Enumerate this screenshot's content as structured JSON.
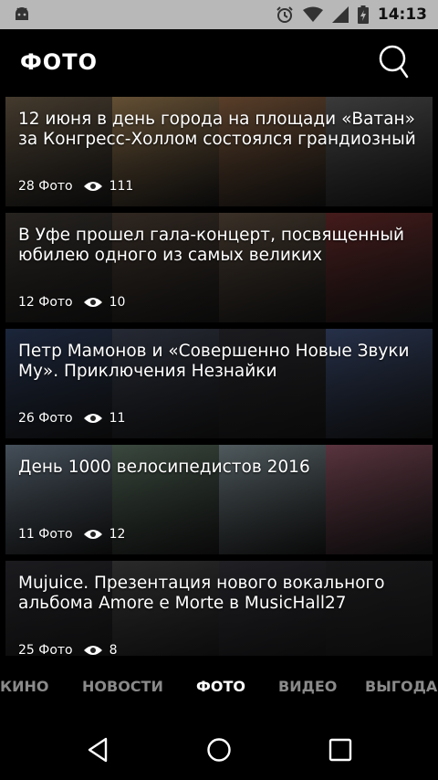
{
  "status_bar": {
    "time": "14:13",
    "icons": [
      "android-icon",
      "alarm-icon",
      "wifi-icon",
      "signal-icon",
      "battery-icon"
    ]
  },
  "header": {
    "title": "ФОТО",
    "search_icon": "search-icon"
  },
  "feed": [
    {
      "title": "12 июня в день города на площади «Ватан» за Конгресс-Холлом состоялся грандиозный",
      "photos": "28 Фото",
      "views": "111",
      "colors": [
        "#6a5a46",
        "#9a7a50",
        "#8a6040",
        "#5a5a5a"
      ]
    },
    {
      "title": "В Уфе прошел гала-концерт, посвященный юбилею одного из самых великих",
      "photos": "12 Фото",
      "views": "10",
      "colors": [
        "#3a3530",
        "#4a3c32",
        "#5a4a3c",
        "#6a2a2a"
      ]
    },
    {
      "title": "Петр Мамонов и «Совершенно Новые Звуки Му». Приключения Незнайки",
      "photos": "26 Фото",
      "views": "11",
      "colors": [
        "#2a3a5a",
        "#3a4050",
        "#2a2a30",
        "#3a4a70"
      ]
    },
    {
      "title": "День 1000 велосипедистов 2016",
      "photos": "11 Фото",
      "views": "12",
      "colors": [
        "#6a7a8a",
        "#5a7060",
        "#7a8a90",
        "#8a5060"
      ]
    },
    {
      "title": "Mujuice. Презентация нового вокального альбома Amore e Morte в MusicHall27",
      "photos": "25 Фото",
      "views": "8",
      "colors": [
        "#2a2a30",
        "#404040",
        "#303038",
        "#252528"
      ]
    }
  ],
  "tabs": [
    {
      "label": "КИНО",
      "active": false
    },
    {
      "label": "НОВОСТИ",
      "active": false
    },
    {
      "label": "ФОТО",
      "active": true
    },
    {
      "label": "ВИДЕО",
      "active": false
    },
    {
      "label": "ВЫГОДА",
      "active": false
    }
  ],
  "nav": [
    "back-icon",
    "home-icon",
    "recents-icon"
  ]
}
